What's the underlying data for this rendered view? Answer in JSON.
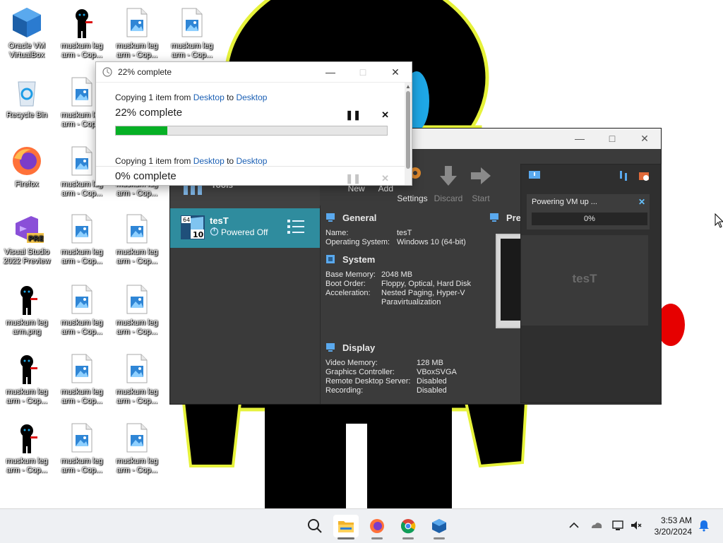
{
  "desktop": {
    "icons": [
      {
        "label": "Oracle VM VirtualBox",
        "icon": "virtualbox-icon"
      },
      {
        "label": "muskum leg arm - Cop...",
        "icon": "character-image-icon"
      },
      {
        "label": "muskum leg arm - Cop...",
        "icon": "image-file-icon"
      },
      {
        "label": "muskum leg arm - Cop...",
        "icon": "image-file-icon"
      },
      {
        "label": "Recycle Bin",
        "icon": "recycle-bin-icon"
      },
      {
        "label": "muskum leg arm - Cop...",
        "icon": "image-file-icon"
      },
      {
        "label": "Firefox",
        "icon": "firefox-icon"
      },
      {
        "label": "muskum leg arm - Cop...",
        "icon": "image-file-icon"
      },
      {
        "label": "muskum leg arm - Cop...",
        "icon": "image-file-icon"
      },
      {
        "label": "Visual Studio 2022 Preview",
        "icon": "visual-studio-icon"
      },
      {
        "label": "muskum leg arm - Cop...",
        "icon": "image-file-icon"
      },
      {
        "label": "muskum leg arm - Cop...",
        "icon": "image-file-icon"
      },
      {
        "label": "muskum leg arm.png",
        "icon": "character-image-icon"
      },
      {
        "label": "muskum leg arm - Cop...",
        "icon": "image-file-icon"
      },
      {
        "label": "muskum leg arm - Cop...",
        "icon": "image-file-icon"
      },
      {
        "label": "muskum leg arm - Cop...",
        "icon": "character-image-icon"
      },
      {
        "label": "muskum leg arm - Cop...",
        "icon": "image-file-icon"
      },
      {
        "label": "muskum leg arm - Cop...",
        "icon": "image-file-icon"
      },
      {
        "label": "muskum leg arm - Cop...",
        "icon": "character-image-icon"
      },
      {
        "label": "muskum leg arm - Cop...",
        "icon": "image-file-icon"
      },
      {
        "label": "muskum leg arm - Cop...",
        "icon": "image-file-icon"
      }
    ]
  },
  "copy_dialog": {
    "title": "22% complete",
    "items": [
      {
        "prefix": "Copying 1 item from ",
        "from": "Desktop",
        "mid": " to ",
        "to": "Desktop",
        "status": "22% complete",
        "progress": 0.19
      },
      {
        "prefix": "Copying 1 item from ",
        "from": "Desktop",
        "mid": " to ",
        "to": "Desktop",
        "status": "0% complete",
        "progress": 0
      }
    ]
  },
  "vbox": {
    "tools_label": "Tools",
    "vm": {
      "name": "tesT",
      "state": "Powered Off",
      "badge": "10",
      "arch": "64"
    },
    "toolbar": [
      {
        "label": "New",
        "enabled": true
      },
      {
        "label": "Add",
        "enabled": true
      },
      {
        "label": "Settings",
        "enabled": true
      },
      {
        "label": "Discard",
        "enabled": false
      },
      {
        "label": "Start",
        "enabled": false
      }
    ],
    "general": {
      "title": "General",
      "rows": [
        {
          "k": "Name:",
          "v": "tesT"
        },
        {
          "k": "Operating System:",
          "v": "Windows 10 (64-bit)"
        }
      ]
    },
    "system": {
      "title": "System",
      "rows": [
        {
          "k": "Base Memory:",
          "v": "2048 MB"
        },
        {
          "k": "Boot Order:",
          "v": "Floppy, Optical, Hard Disk"
        },
        {
          "k": "Acceleration:",
          "v": "Nested Paging, Hyper-V Paravirtualization"
        }
      ]
    },
    "display": {
      "title": "Display",
      "rows": [
        {
          "k": "Video Memory:",
          "v": "128 MB"
        },
        {
          "k": "Graphics Controller:",
          "v": "VBoxSVGA"
        },
        {
          "k": "Remote Desktop Server:",
          "v": "Disabled"
        },
        {
          "k": "Recording:",
          "v": "Disabled"
        }
      ]
    },
    "preview_title": "Prev",
    "notification": {
      "title": "Powering VM up ...",
      "progress_text": "0%",
      "preview_name": "tesT"
    }
  },
  "taskbar": {
    "apps": [
      "search-icon",
      "file-explorer-icon",
      "firefox-icon",
      "chrome-icon",
      "virtualbox-icon"
    ],
    "time": "3:53 AM",
    "date": "3/20/2024"
  }
}
